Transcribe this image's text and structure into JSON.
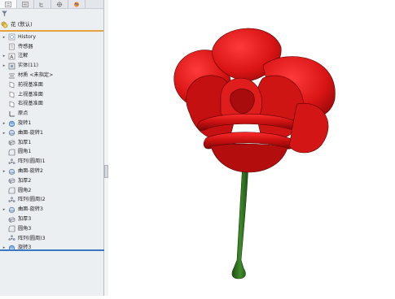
{
  "tree": {
    "root_label": "花 (默认)",
    "items": [
      {
        "label": "History",
        "icon": "history-icon",
        "expand": "▸"
      },
      {
        "label": "传感器",
        "icon": "sensor-icon",
        "expand": ""
      },
      {
        "label": "注解",
        "icon": "annotation-icon",
        "expand": "▸"
      },
      {
        "label": "实体(11)",
        "icon": "solid-bodies-icon",
        "expand": "▸"
      },
      {
        "label": "材质 <未指定>",
        "icon": "material-icon",
        "expand": ""
      },
      {
        "label": "前视基准面",
        "icon": "plane-icon",
        "expand": ""
      },
      {
        "label": "上视基准面",
        "icon": "plane-icon",
        "expand": ""
      },
      {
        "label": "右视基准面",
        "icon": "plane-icon",
        "expand": ""
      },
      {
        "label": "原点",
        "icon": "origin-icon",
        "expand": ""
      },
      {
        "label": "旋转1",
        "icon": "revolve-icon",
        "expand": "▸"
      },
      {
        "label": "曲面-旋转1",
        "icon": "surface-revolve-icon",
        "expand": "▸"
      },
      {
        "label": "加厚1",
        "icon": "thicken-icon",
        "expand": ""
      },
      {
        "label": "圆角1",
        "icon": "fillet-icon",
        "expand": ""
      },
      {
        "label": "阵列(圆周)1",
        "icon": "circular-pattern-icon",
        "expand": ""
      },
      {
        "label": "曲面-旋转2",
        "icon": "surface-revolve-icon",
        "expand": "▸"
      },
      {
        "label": "加厚2",
        "icon": "thicken-icon",
        "expand": ""
      },
      {
        "label": "圆角2",
        "icon": "fillet-icon",
        "expand": ""
      },
      {
        "label": "阵列(圆周)2",
        "icon": "circular-pattern-icon",
        "expand": ""
      },
      {
        "label": "曲面-旋转3",
        "icon": "surface-revolve-icon",
        "expand": "▸"
      },
      {
        "label": "加厚3",
        "icon": "thicken-icon",
        "expand": ""
      },
      {
        "label": "圆角3",
        "icon": "fillet-icon",
        "expand": ""
      },
      {
        "label": "阵列(圆周)3",
        "icon": "circular-pattern-icon",
        "expand": ""
      },
      {
        "label": "旋转3",
        "icon": "revolve-icon",
        "expand": "▸"
      }
    ]
  },
  "panel_tabs": [
    "feature-manager-icon",
    "property-manager-icon",
    "configuration-manager-icon",
    "dimxpert-icon",
    "display-manager-icon"
  ],
  "colors": {
    "petal": "#d61a1a",
    "petal_dark": "#8e0b0b",
    "stem": "#2f6b1f",
    "accent": "#e6a23c",
    "selection_line": "#3a78c4"
  }
}
